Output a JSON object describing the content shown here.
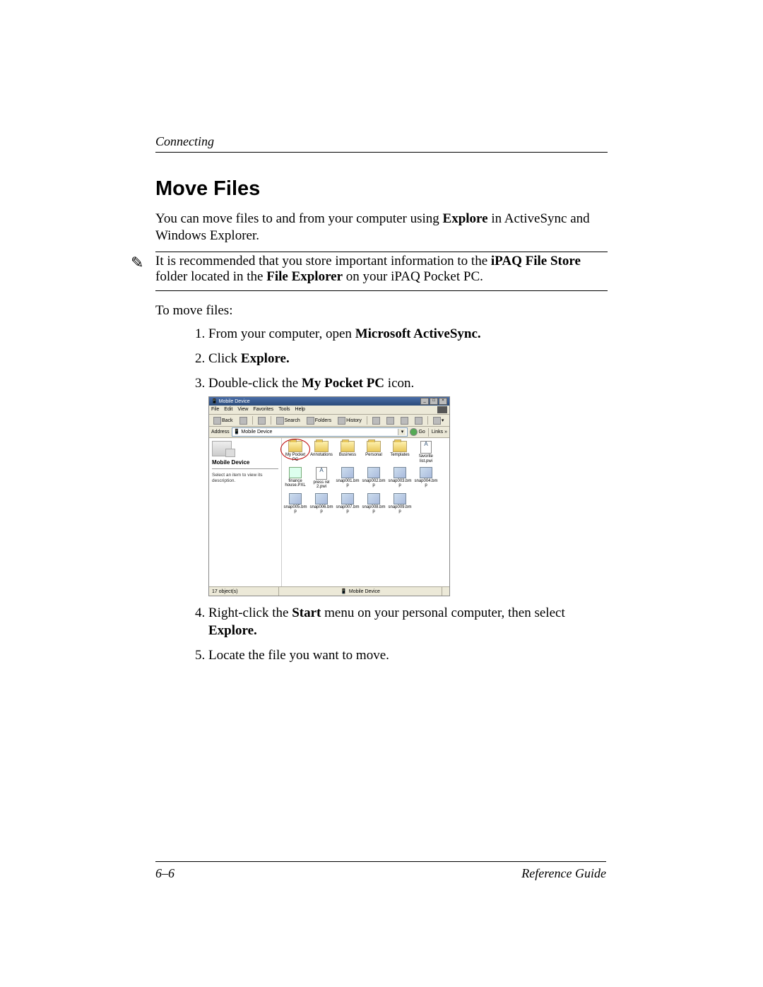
{
  "header": {
    "chapter_title": "Connecting"
  },
  "section": {
    "title": "Move Files"
  },
  "intro": {
    "pre": "You can move files to and from your computer using ",
    "bold": "Explore",
    "post": " in ActiveSync and Windows Explorer."
  },
  "note": {
    "pre": "It is recommended that you store important information to the ",
    "b1": "iPAQ File Store",
    "mid": " folder located in the ",
    "b2": "File Explorer",
    "post": " on your iPAQ Pocket PC."
  },
  "tomove": "To move files:",
  "step1": {
    "pre": "From your computer, open ",
    "bold": "Microsoft ActiveSync."
  },
  "step2": {
    "pre": "Click ",
    "bold": "Explore."
  },
  "step3": {
    "pre": "Double-click the ",
    "bold": "My Pocket PC",
    "post": " icon."
  },
  "step4": {
    "pre": "Right-click the ",
    "b1": "Start",
    "mid": " menu on your personal computer, then select ",
    "b2": "Explore."
  },
  "step5": {
    "text": "Locate the file you want to move."
  },
  "footer": {
    "page": "6–6",
    "book": "Reference Guide"
  },
  "screenshot": {
    "window_title": "Mobile Device",
    "menus": [
      "File",
      "Edit",
      "View",
      "Favorites",
      "Tools",
      "Help"
    ],
    "toolbar_back": "Back",
    "toolbar_search": "Search",
    "toolbar_folders": "Folders",
    "toolbar_history": "History",
    "address_label": "Address",
    "address_value": "Mobile Device",
    "go_label": "Go",
    "links_label": "Links",
    "side_title": "Mobile Device",
    "side_desc": "Select an item to view its description.",
    "row1": [
      {
        "label": "My Pocket PC",
        "type": "tab",
        "highlight": true
      },
      {
        "label": "Annotations",
        "type": "tab"
      },
      {
        "label": "Business",
        "type": "tab"
      },
      {
        "label": "Personal",
        "type": "tab"
      },
      {
        "label": "Templates",
        "type": "tab"
      },
      {
        "label": "favorite list.pwi",
        "type": "doc"
      }
    ],
    "row2": [
      {
        "label": "finance house.PXL",
        "type": "pxl"
      },
      {
        "label": "press rel 2.pwi",
        "type": "doc"
      },
      {
        "label": "snap001.bmp",
        "type": "bmp"
      },
      {
        "label": "snap002.bmp",
        "type": "bmp"
      },
      {
        "label": "snap003.bmp",
        "type": "bmp"
      },
      {
        "label": "snap004.bmp",
        "type": "bmp"
      }
    ],
    "row3": [
      {
        "label": "snap005.bmp",
        "type": "bmp"
      },
      {
        "label": "snap006.bmp",
        "type": "bmp"
      },
      {
        "label": "snap007.bmp",
        "type": "bmp"
      },
      {
        "label": "snap008.bmp",
        "type": "bmp"
      },
      {
        "label": "snap009.bmp",
        "type": "bmp"
      }
    ],
    "status_count": "17 object(s)",
    "status_location": "Mobile Device"
  }
}
